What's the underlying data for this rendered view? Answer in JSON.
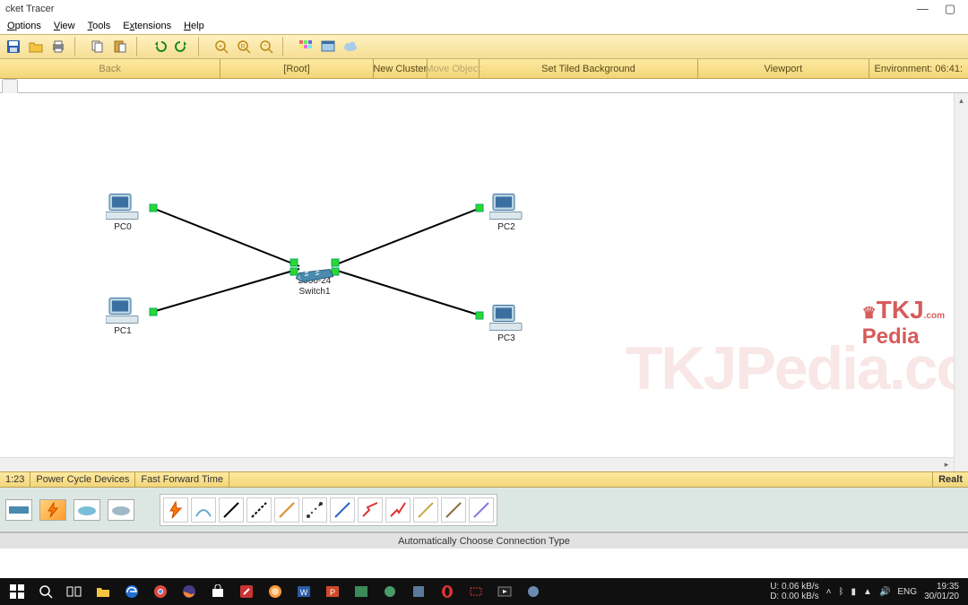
{
  "window": {
    "title": "cket Tracer",
    "controls": {
      "min": "—",
      "max": "▢",
      "close": ""
    }
  },
  "menu": [
    "Options",
    "View",
    "Tools",
    "Extensions",
    "Help"
  ],
  "secondbar": {
    "back": "Back",
    "root": "[Root]",
    "newcluster": "New Cluster",
    "moveobj": "Move Object",
    "tiled": "Set Tiled Background",
    "viewport": "Viewport",
    "env": "Environment: 06:41:"
  },
  "devices": {
    "pc0": {
      "type": "PC-PT",
      "name": "PC0"
    },
    "pc1": {
      "type": "PC-PT",
      "name": "PC1"
    },
    "pc2": {
      "type": "PC-PT",
      "name": "PC2"
    },
    "pc3": {
      "type": "PC-PT",
      "name": "PC3"
    },
    "sw": {
      "type": "2950-24",
      "name": "Switch1"
    }
  },
  "status": {
    "time": "1:23",
    "powercycle": "Power Cycle Devices",
    "fastfwd": "Fast Forward Time",
    "mode": "Realt"
  },
  "footer": {
    "hint": "Automatically Choose Connection Type"
  },
  "watermark": {
    "line1_a": "TKJ",
    "line1_b": ".com",
    "line2": "Pedia",
    "big": "TKJPedia.co"
  },
  "taskbar": {
    "net": {
      "u": "U:",
      "uval": "0.06 kB/s",
      "d": "D:",
      "dval": "0.00 kB/s"
    },
    "lang": "ENG",
    "clock": {
      "time": "19:35",
      "date": "30/01/20"
    }
  }
}
